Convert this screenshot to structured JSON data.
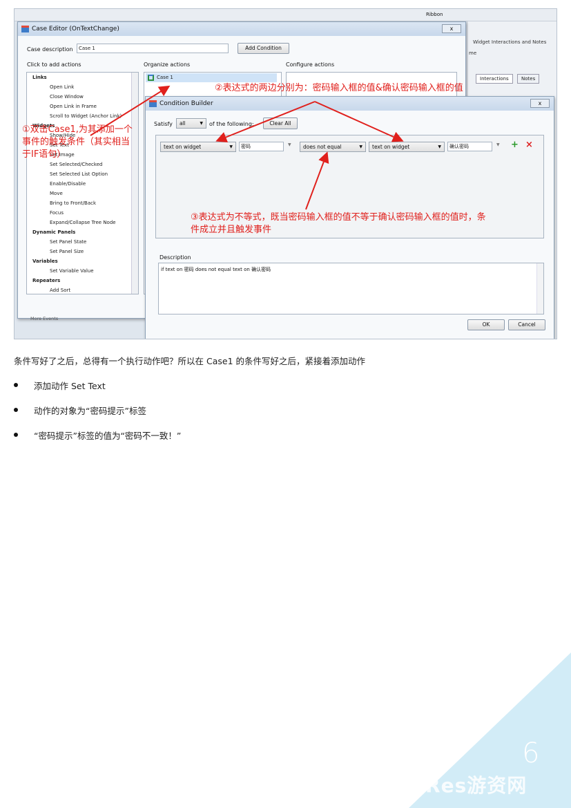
{
  "case_editor": {
    "title": "Case Editor (OnTextChange)",
    "close": "x",
    "case_description_label": "Case description",
    "case_description_value": "Case 1",
    "add_condition": "Add Condition",
    "click_to_add": "Click to add actions",
    "organize": "Organize actions",
    "configure": "Configure actions",
    "case_item": "Case 1",
    "tree": [
      {
        "label": "Links",
        "bold": true
      },
      {
        "label": "Open Link",
        "bold": false
      },
      {
        "label": "Close Window",
        "bold": false
      },
      {
        "label": "Open Link in Frame",
        "bold": false
      },
      {
        "label": "Scroll to Widget (Anchor Link)",
        "bold": false
      },
      {
        "label": "Widgets",
        "bold": true
      },
      {
        "label": "Show/Hide",
        "bold": false
      },
      {
        "label": "Set Text",
        "bold": false
      },
      {
        "label": "Set Image",
        "bold": false
      },
      {
        "label": "Set Selected/Checked",
        "bold": false
      },
      {
        "label": "Set Selected List Option",
        "bold": false
      },
      {
        "label": "Enable/Disable",
        "bold": false
      },
      {
        "label": "Move",
        "bold": false
      },
      {
        "label": "Bring to Front/Back",
        "bold": false
      },
      {
        "label": "Focus",
        "bold": false
      },
      {
        "label": "Expand/Collapse Tree Node",
        "bold": false
      },
      {
        "label": "Dynamic Panels",
        "bold": true
      },
      {
        "label": "Set Panel State",
        "bold": false
      },
      {
        "label": "Set Panel Size",
        "bold": false
      },
      {
        "label": "Variables",
        "bold": true
      },
      {
        "label": "Set Variable Value",
        "bold": false
      },
      {
        "label": "Repeaters",
        "bold": true
      },
      {
        "label": "Add Sort",
        "bold": false
      }
    ],
    "more_events": "More Events"
  },
  "right_panel": {
    "title": "Widget Interactions and Notes",
    "name_label": "me",
    "tab_interactions": "Interactions",
    "tab_notes": "Notes",
    "top_label": "Ribbon"
  },
  "condition_builder": {
    "title": "Condition Builder",
    "close": "x",
    "satisfy_label": "Satisfy",
    "satisfy_value": "all",
    "of_following": "of the following:",
    "clear_all": "Clear All",
    "left_type": "text on widget",
    "left_value": "密码",
    "operator": "does not equal",
    "right_type": "text on widget",
    "right_value": "确认密码",
    "add_symbol": "+",
    "remove_symbol": "×",
    "description_label": "Description",
    "description_text": "if text on 密码 does not equal text on 确认密码",
    "ok": "OK",
    "cancel": "Cancel"
  },
  "annotations": {
    "a1_line1": "①双击Case1,为其添加一个",
    "a1_line2": "事件的触发条件（其实相当",
    "a1_line3": "于IF语句）",
    "a2": "②表达式的两边分别为：密码输入框的值&确认密码输入框的值",
    "a3_line1": "③表达式为不等式，既当密码输入框的值不等于确认密码输入框的值时，条",
    "a3_line2": "件成立并且触发事件"
  },
  "body_text": {
    "paragraph": "条件写好了之后，总得有一个执行动作吧？所以在 Case1 的条件写好之后，紧接着添加动作",
    "bullets": [
      "添加动作 Set Text",
      "动作的对象为“密码提示”标签",
      "“密码提示”标签的值为“密码不一致！”"
    ]
  },
  "footer": {
    "page_number": "6",
    "watermark": "GameRes游资网"
  },
  "colors": {
    "annotation_red": "#e0201c",
    "corner_triangle": "#d2ecf7"
  }
}
